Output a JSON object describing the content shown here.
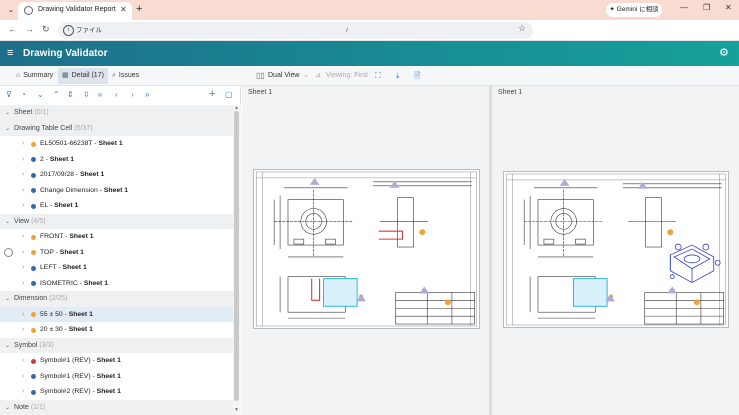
{
  "browser": {
    "tab_title": "Drawing Validator Report",
    "chip_label": "ファイル",
    "url_text": "/",
    "gemini_label": "✦ Gemini に相談"
  },
  "app": {
    "title": "Drawing Validator"
  },
  "nav_tabs": [
    {
      "label": "Summary",
      "icon": "home-icon"
    },
    {
      "label": "Detail (17)",
      "icon": "table-icon"
    },
    {
      "label": "Issues",
      "icon": "issues-icon"
    }
  ],
  "viewer_toolbar": {
    "dual_view": "Dual View",
    "viewing_first": "Viewing: First"
  },
  "tree": [
    {
      "group": "Sheet",
      "count": "(0/1)",
      "items": []
    },
    {
      "group": "Drawing Table Cell",
      "count": "(5/37)",
      "items": [
        {
          "label": "EL50501-66238T",
          "sheet": "Sheet 1",
          "color": "#f0a23a"
        },
        {
          "label": "2",
          "sheet": "Sheet 1",
          "color": "#3568b0"
        },
        {
          "label": "2017/09/28",
          "sheet": "Sheet 1",
          "color": "#3568b0"
        },
        {
          "label": "Change Dimension",
          "sheet": "Sheet 1",
          "color": "#3568b0"
        },
        {
          "label": "EL",
          "sheet": "Sheet 1",
          "color": "#3568b0"
        }
      ]
    },
    {
      "group": "View",
      "count": "(4/5)",
      "items": [
        {
          "label": "FRONT",
          "sheet": "Sheet 1",
          "color": "#f0a23a"
        },
        {
          "label": "TOP",
          "sheet": "Sheet 1",
          "color": "#f0a23a"
        },
        {
          "label": "LEFT",
          "sheet": "Sheet 1",
          "color": "#3568b0"
        },
        {
          "label": "ISOMETRIC",
          "sheet": "Sheet 1",
          "color": "#3568b0"
        }
      ]
    },
    {
      "group": "Dimension",
      "count": "(2/25)",
      "items": [
        {
          "label": "55 ± 50",
          "sheet": "Sheet 1",
          "color": "#f0a23a"
        },
        {
          "label": "20 ± 30",
          "sheet": "Sheet 1",
          "color": "#f0a23a"
        }
      ]
    },
    {
      "group": "Symbol",
      "count": "(3/3)",
      "items": [
        {
          "label": "Symbol#1 (REV)",
          "sheet": "Sheet 1",
          "color": "#d23a3a"
        },
        {
          "label": "Symbol#1 (REV)",
          "sheet": "Sheet 1",
          "color": "#3568b0"
        },
        {
          "label": "Symbol#2 (REV)",
          "sheet": "Sheet 1",
          "color": "#3568b0"
        }
      ]
    },
    {
      "group": "Note",
      "count": "(1/1)",
      "items": []
    }
  ],
  "panes": {
    "left_title": "Sheet 1",
    "right_title": "Sheet 1"
  },
  "colors": {
    "header_start": "#1e6f8a",
    "header_end": "#17a19b",
    "accent": "#3a7fc4",
    "issue_orange": "#f0a23a",
    "ok_blue": "#3568b0",
    "error_red": "#d23a3a",
    "highlight_cyan": "#2ab4e6"
  }
}
